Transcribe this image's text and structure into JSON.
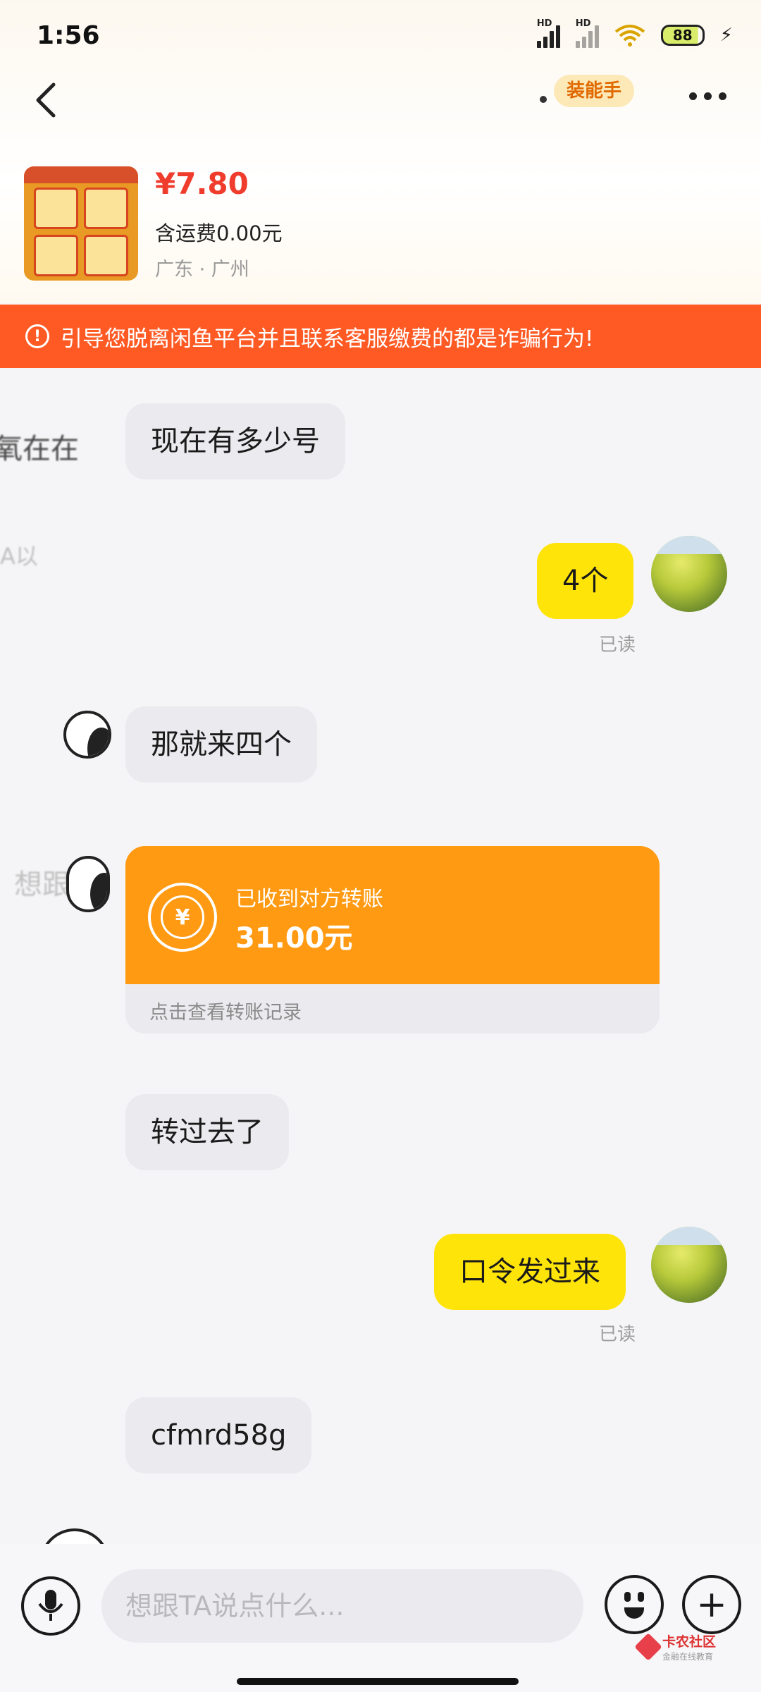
{
  "status_bar": {
    "time": "1:56",
    "battery": "88"
  },
  "header": {
    "helper_badge": "装能手"
  },
  "product": {
    "price": "¥7.80",
    "shipping": "含运费0.00元",
    "location": "广东 · 广州"
  },
  "warning": {
    "icon": "!",
    "text": "引导您脱离闲鱼平台并且联系客服缴费的都是诈骗行为!"
  },
  "messages": [
    {
      "side": "in",
      "text": "现在有多少号"
    },
    {
      "side": "out",
      "text": "4个",
      "receipt": "已读"
    },
    {
      "side": "in",
      "text": "那就来四个"
    },
    {
      "side": "out",
      "text": "口令发过来",
      "receipt": "已读"
    },
    {
      "side": "in",
      "text": "转过去了"
    },
    {
      "side": "in",
      "text": "cfmrd58g"
    }
  ],
  "ghost_text": {
    "left_1": "氧在在",
    "left_2": "A以",
    "left_3": "想跟"
  },
  "transfer": {
    "title": "已收到对方转账",
    "amount": "31.00元",
    "link": "点击查看转账记录",
    "icon": "¥"
  },
  "input_bar": {
    "placeholder": "想跟TA说点什么...",
    "plus": "+"
  },
  "watermark": {
    "title": "卡农社区",
    "subtitle": "金融在线教育"
  },
  "colors": {
    "warning_bg": "#ff5a24",
    "price": "#f03c2c",
    "out_bubble": "#ffe40a",
    "transfer_bg": "#ff9a12"
  }
}
